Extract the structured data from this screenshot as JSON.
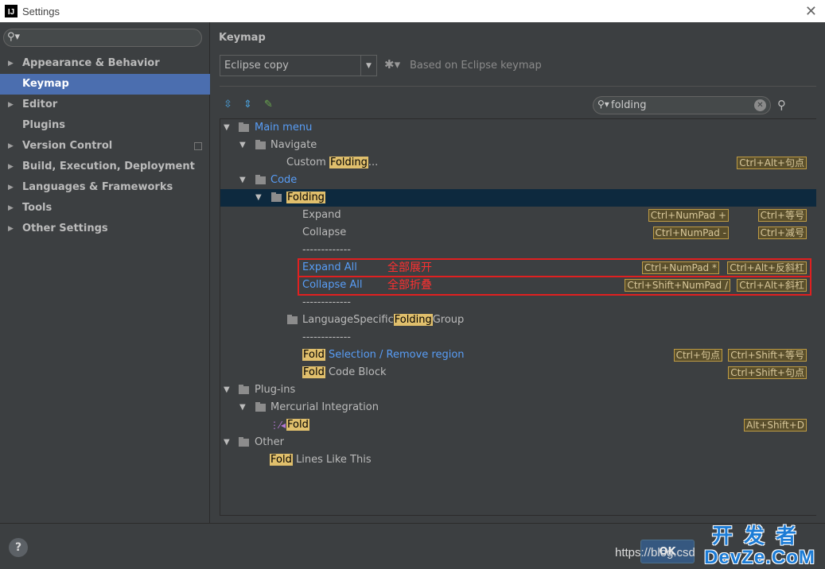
{
  "window": {
    "logo": "IJ",
    "title": "Settings",
    "close": "✕"
  },
  "sidebar": {
    "search_placeholder": "",
    "items": [
      {
        "label": "Appearance & Behavior",
        "arrow": "▶"
      },
      {
        "label": "Keymap",
        "arrow": ""
      },
      {
        "label": "Editor",
        "arrow": "▶"
      },
      {
        "label": "Plugins",
        "arrow": ""
      },
      {
        "label": "Version Control",
        "arrow": "▶"
      },
      {
        "label": "Build, Execution, Deployment",
        "arrow": "▶"
      },
      {
        "label": "Languages & Frameworks",
        "arrow": "▶"
      },
      {
        "label": "Tools",
        "arrow": "▶"
      },
      {
        "label": "Other Settings",
        "arrow": "▶"
      }
    ]
  },
  "main": {
    "title": "Keymap",
    "keymap_value": "Eclipse copy",
    "based_on": "Based on Eclipse keymap",
    "filter_value": "folding"
  },
  "tree": {
    "main_menu": "Main menu",
    "navigate": "Navigate",
    "custom_pre": "Custom ",
    "custom_hl": "Folding",
    "custom_post": "...",
    "custom_sc": "Ctrl+Alt+句点",
    "code": "Code",
    "folding": "Folding",
    "expand": "Expand",
    "expand_sc1": "Ctrl+NumPad +",
    "expand_sc2": "Ctrl+等号",
    "collapse": "Collapse",
    "collapse_sc1": "Ctrl+NumPad -",
    "collapse_sc2": "Ctrl+减号",
    "separator": "-------------",
    "expand_all": "Expand All",
    "expand_all_note": "全部展开",
    "expand_all_sc1": "Ctrl+NumPad *",
    "expand_all_sc2": "Ctrl+Alt+反斜杠",
    "collapse_all": "Collapse All",
    "collapse_all_note": "全部折叠",
    "collapse_all_sc1": "Ctrl+Shift+NumPad /",
    "collapse_all_sc2": "Ctrl+Alt+斜杠",
    "lang_pre": "LanguageSpecific",
    "lang_hl": "Folding",
    "lang_post": "Group",
    "fold_sel_hl": "Fold",
    "fold_sel_post": " Selection / Remove region",
    "fold_sel_sc1": "Ctrl+句点",
    "fold_sel_sc2": "Ctrl+Shift+等号",
    "fold_block_hl": "Fold",
    "fold_block_post": " Code Block",
    "fold_block_sc": "Ctrl+Shift+句点",
    "plugins": "Plug-ins",
    "mercurial": "Mercurial Integration",
    "merc_fold": "Fold",
    "merc_fold_sc": "Alt+Shift+D",
    "other": "Other",
    "fold_lines_hl": "Fold",
    "fold_lines_post": " Lines Like This"
  },
  "bottom": {
    "help": "?",
    "ok": "OK",
    "watermark_url": "https://blog.csd",
    "watermark_cn": "开发者",
    "watermark_en": "DevZe.CoM"
  },
  "colors": {
    "selection": "#4b6eaf",
    "highlight": "#e0bf6c",
    "link": "#589df6",
    "annotation": "#ff3030"
  }
}
